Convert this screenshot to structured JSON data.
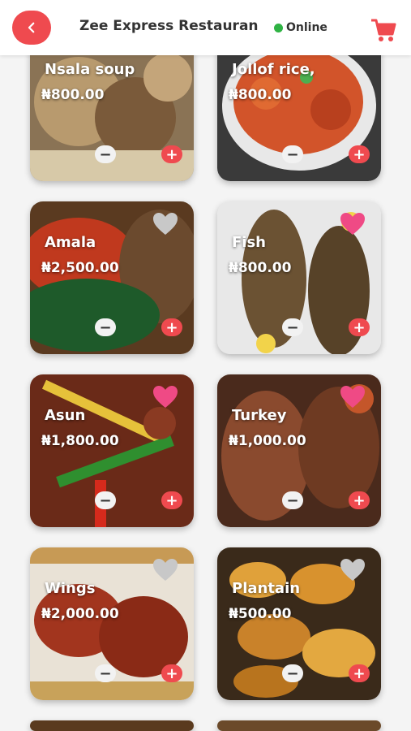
{
  "header": {
    "title": "Zee Express Restaurant",
    "status": "Online",
    "colors": {
      "accent": "#ef4a4f",
      "online": "#2fb344"
    }
  },
  "items": [
    {
      "name": "Nsala soup",
      "price": "₦800.00",
      "liked": null
    },
    {
      "name": "Jollof rice,",
      "price": "₦800.00",
      "liked": null
    },
    {
      "name": "Amala",
      "price": "₦2,500.00",
      "liked": false
    },
    {
      "name": "Fish",
      "price": "₦800.00",
      "liked": true
    },
    {
      "name": "Asun",
      "price": "₦1,800.00",
      "liked": true
    },
    {
      "name": "Turkey",
      "price": "₦1,000.00",
      "liked": true
    },
    {
      "name": "Wings",
      "price": "₦2,000.00",
      "liked": false
    },
    {
      "name": "Plantain",
      "price": "₦500.00",
      "liked": false
    }
  ],
  "controls": {
    "minus": "−",
    "plus": "+"
  },
  "icons": {
    "back": "chevron-left-icon",
    "cart": "cart-icon",
    "heart": "heart-icon"
  }
}
